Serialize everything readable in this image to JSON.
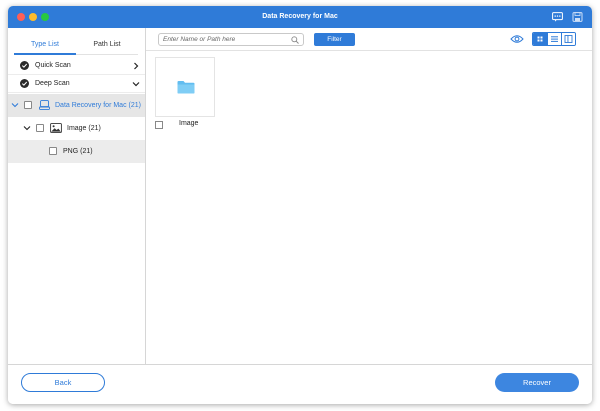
{
  "window": {
    "title": "Data Recovery for Mac"
  },
  "titlebar_icons": [
    "feedback-icon",
    "save-icon"
  ],
  "sidebar": {
    "tabs": [
      {
        "label": "Type List",
        "active": true
      },
      {
        "label": "Path List",
        "active": false
      }
    ],
    "scans": [
      {
        "label": "Quick Scan",
        "expanded": false
      },
      {
        "label": "Deep Scan",
        "expanded": true
      }
    ],
    "tree": [
      {
        "label": "Data Recovery for Mac (21)",
        "level": 0,
        "selected": true,
        "icon": "drive-icon"
      },
      {
        "label": "Image (21)",
        "level": 1,
        "selected": false,
        "icon": "image-icon"
      },
      {
        "label": "PNG (21)",
        "level": 2,
        "selected": false,
        "icon": ""
      }
    ]
  },
  "toolbar": {
    "search_placeholder": "Enter Name or Path here",
    "filter_label": "Filter",
    "active_view": "grid"
  },
  "content": {
    "items": [
      {
        "label": "Image",
        "icon": "folder-icon"
      }
    ]
  },
  "footer": {
    "back_label": "Back",
    "recover_label": "Recover"
  },
  "colors": {
    "accent": "#2f7bd8",
    "titlebar": "#2f7bd8",
    "selected_row": "#e6e6e6",
    "folder": "#62bdf0"
  }
}
